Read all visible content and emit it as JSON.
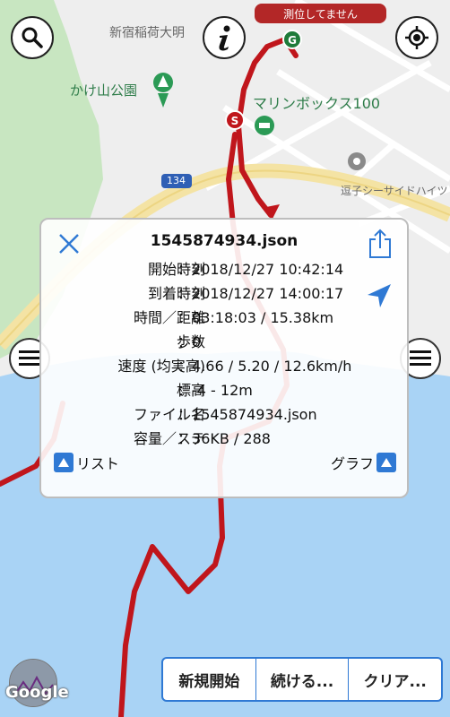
{
  "status": {
    "text": "測位してません"
  },
  "map": {
    "labels": {
      "shrine": "新宿稲荷大明",
      "park": "かけ山公園",
      "marina": "マリンボックス100",
      "seaside": "逗子シーサイドハイツ",
      "route_number": "134"
    },
    "markers": {
      "start": "S",
      "goal": "G"
    },
    "attribution": "Google"
  },
  "panel": {
    "filename": "1545874934.json",
    "rows": [
      {
        "label": "開始時刻",
        "value": "2018/12/27 10:42:14"
      },
      {
        "label": "到着時刻",
        "value": "2018/12/27 14:00:17"
      },
      {
        "label": "時間／距離",
        "value": "03:18:03 / 15.38km"
      },
      {
        "label": "歩数",
        "value": "0"
      },
      {
        "label": "速度 (均実高)",
        "value": "4.66 / 5.20 / 12.6km/h"
      },
      {
        "label": "標高",
        "value": "-4 - 12m"
      },
      {
        "label": "ファイル名",
        "value": "1545874934.json"
      },
      {
        "label": "容量／ステ",
        "value": "36KB / 288"
      }
    ],
    "list_label": "リスト",
    "graph_label": "グラフ"
  },
  "bottom_buttons": {
    "new": "新規開始",
    "continue": "続ける...",
    "clear": "クリア..."
  },
  "colors": {
    "accent": "#2f79d4",
    "route": "#c0161c",
    "status": "#b32727",
    "water": "#a9d3f5"
  },
  "icons": [
    "search-icon",
    "info-icon",
    "locate-icon",
    "menu-icon",
    "close-icon",
    "share-icon",
    "navigation-arrow-icon"
  ]
}
